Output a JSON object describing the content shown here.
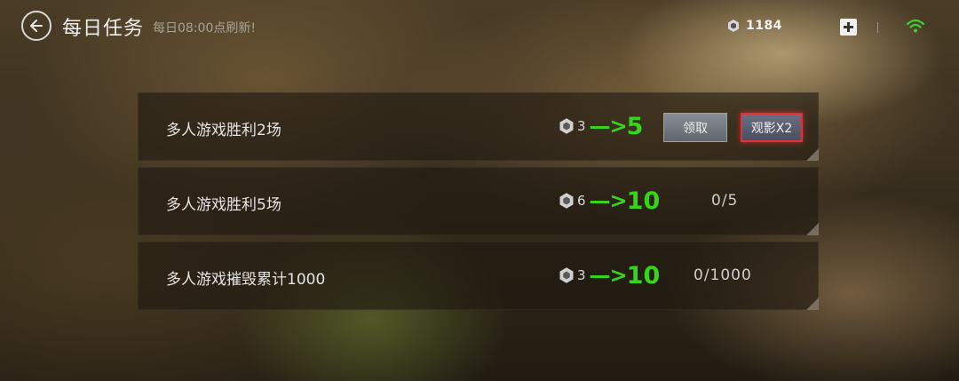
{
  "header": {
    "title": "每日任务",
    "refresh_note": "每日08:00点刷新!",
    "currency_value": "1184"
  },
  "tasks": [
    {
      "name": "多人游戏胜利2场",
      "reward_old": "3",
      "reward_arrow": "—>",
      "reward_new": "5",
      "claim_label": "领取",
      "watch_label": "观影X2"
    },
    {
      "name": "多人游戏胜利5场",
      "reward_old": "6",
      "reward_arrow": "—>",
      "reward_new": "10",
      "progress": "0/5"
    },
    {
      "name": "多人游戏摧毁累计1000",
      "reward_old": "3",
      "reward_arrow": "—>",
      "reward_new": "10",
      "progress": "0/1000"
    }
  ],
  "colors": {
    "accent_green": "#35d51c",
    "highlight_red": "#e0303a",
    "wifi_green": "#3ccf2e"
  },
  "icons": {
    "back": "back-arrow-icon",
    "currency": "hex-gem-icon",
    "add": "plus-icon",
    "wifi": "wifi-icon"
  }
}
